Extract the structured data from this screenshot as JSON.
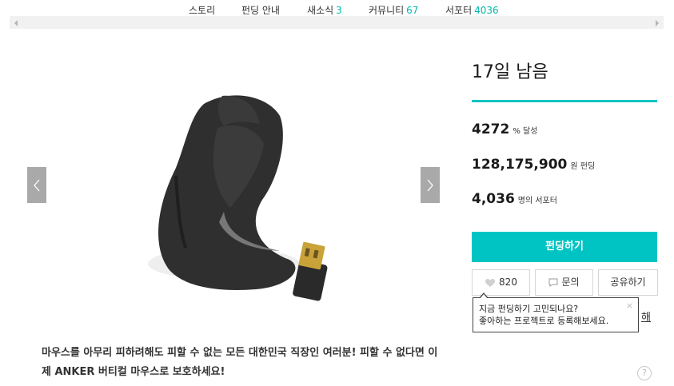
{
  "tabs": [
    {
      "label": "스토리",
      "count": ""
    },
    {
      "label": "펀딩 안내",
      "count": ""
    },
    {
      "label": "새소식",
      "count": "3"
    },
    {
      "label": "커뮤니티",
      "count": "67"
    },
    {
      "label": "서포터",
      "count": "4036"
    }
  ],
  "headline": "마우스를 아무리 피하려해도 피할 수 없는 모든 대한민국 직장인 여러분! 피할 수 없다면 이제 ANKER 버티컬 마우스로 보호하세요!",
  "side": {
    "days_left": "17일 남음",
    "percent": {
      "value": "4272",
      "unit": "% 달성"
    },
    "amount": {
      "value": "128,175,900",
      "unit": "원 펀딩"
    },
    "supporters": {
      "value": "4,036",
      "unit": "명의 서포터"
    },
    "fund_button": "펀딩하기",
    "like_count": "820",
    "inquiry": "문의",
    "share": "공유하기",
    "tooltip_line1": "지금 펀딩하기 고민되나요?",
    "tooltip_line2": "좋아하는 프로젝트로 등록해보세요.",
    "tooltip_close": "×",
    "link_fragment": "해",
    "help": "?"
  },
  "colors": {
    "accent": "#00c4c4",
    "nav": "#a9a9a9"
  },
  "icons": [
    "chevron-left-icon",
    "chevron-right-icon",
    "heart-icon",
    "chat-icon",
    "help-icon"
  ]
}
